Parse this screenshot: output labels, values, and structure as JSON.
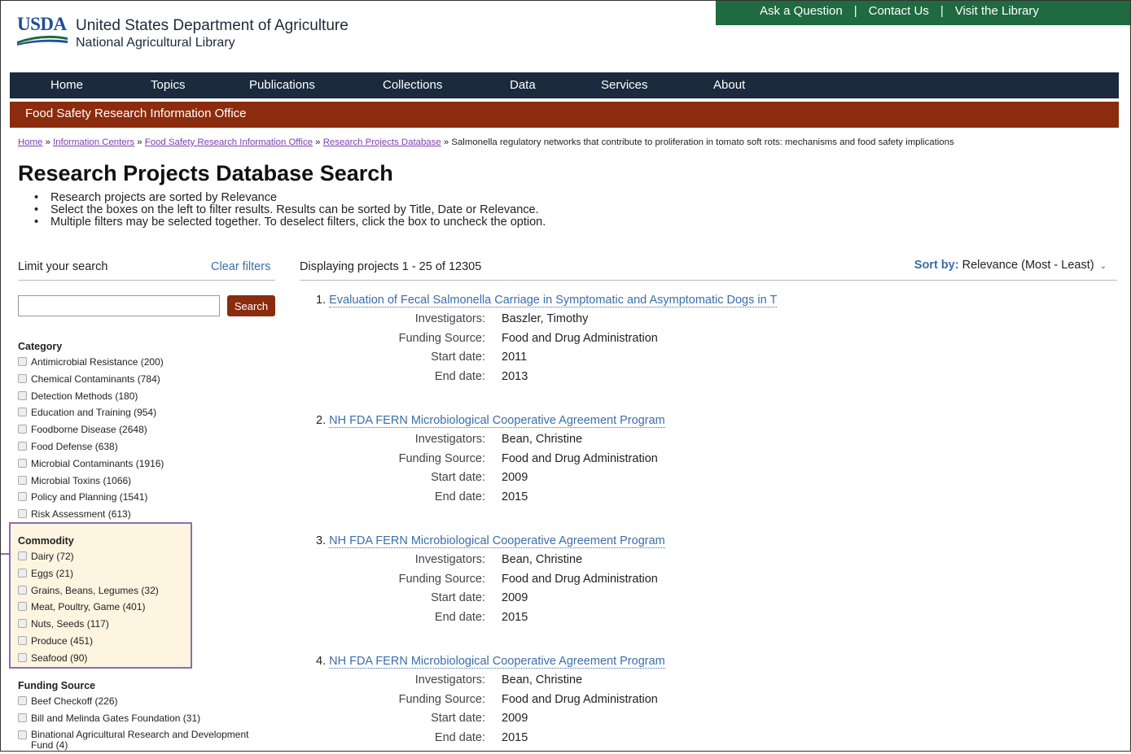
{
  "header": {
    "logo_text": "USDA",
    "department": "United States Department of Agriculture",
    "library": "National Agricultural Library",
    "top_links": [
      "Ask a Question",
      "Contact Us",
      "Visit the Library"
    ],
    "separator": "|"
  },
  "nav": {
    "items": [
      "Home",
      "Topics",
      "Publications",
      "Collections",
      "Data",
      "Services",
      "About"
    ]
  },
  "subnav": {
    "title": "Food Safety Research Information Office"
  },
  "breadcrumb": {
    "links": [
      "Home",
      "Information Centers",
      "Food Safety Research Information Office",
      "Research Projects Database"
    ],
    "sep": "»",
    "current": "Salmonella regulatory networks that contribute to proliferation in tomato soft rots: mechanisms and food safety implications"
  },
  "page": {
    "title": "Research Projects Database Search",
    "bullets": [
      "Research projects are sorted by Relevance",
      "Select the boxes on the left to filter results. Results can be sorted by Title, Date or Relevance.",
      "Multiple filters may be selected together. To deselect filters, click the box to uncheck the option."
    ]
  },
  "sidebar": {
    "limit_label": "Limit your search",
    "clear_filters": "Clear filters",
    "search_placeholder": "",
    "search_button": "Search",
    "category": {
      "title": "Category",
      "items": [
        "Antimicrobial Resistance (200)",
        "Chemical Contaminants (784)",
        "Detection Methods (180)",
        "Education and Training (954)",
        "Foodborne Disease (2648)",
        "Food Defense (638)",
        "Microbial Contaminants (1916)",
        "Microbial Toxins (1066)",
        "Policy and Planning (1541)",
        "Risk Assessment (613)"
      ]
    },
    "commodity": {
      "title": "Commodity",
      "items": [
        "Dairy (72)",
        "Eggs (21)",
        "Grains, Beans, Legumes (32)",
        "Meat, Poultry, Game (401)",
        "Nuts, Seeds (117)",
        "Produce (451)",
        "Seafood (90)"
      ]
    },
    "funding": {
      "title": "Funding Source",
      "items": [
        "Beef Checkoff (226)",
        "Bill and Melinda Gates Foundation (31)",
        "Binational Agricultural Research and Development Fund (4)"
      ]
    }
  },
  "results": {
    "displaying": "Displaying projects 1 - 25 of 12305",
    "sort_label": "Sort by:",
    "sort_value": "Relevance (Most - Least)",
    "labels": {
      "investigators": "Investigators:",
      "funding": "Funding Source:",
      "start": "Start date:",
      "end": "End date:"
    },
    "items": [
      {
        "num": "1.",
        "title": "Evaluation of Fecal Salmonella Carriage in Symptomatic and Asymptomatic Dogs in T",
        "investigators": "Baszler, Timothy",
        "funding": "Food and Drug Administration",
        "start": "2011",
        "end": "2013"
      },
      {
        "num": "2.",
        "title": "NH FDA FERN Microbiological Cooperative Agreement Program",
        "investigators": "Bean, Christine",
        "funding": "Food and Drug Administration",
        "start": "2009",
        "end": "2015"
      },
      {
        "num": "3.",
        "title": "NH FDA FERN Microbiological Cooperative Agreement Program",
        "investigators": "Bean, Christine",
        "funding": "Food and Drug Administration",
        "start": "2009",
        "end": "2015"
      },
      {
        "num": "4.",
        "title": "NH FDA FERN Microbiological Cooperative Agreement Program",
        "investigators": "Bean, Christine",
        "funding": "Food and Drug Administration",
        "start": "2009",
        "end": "2015"
      }
    ]
  }
}
